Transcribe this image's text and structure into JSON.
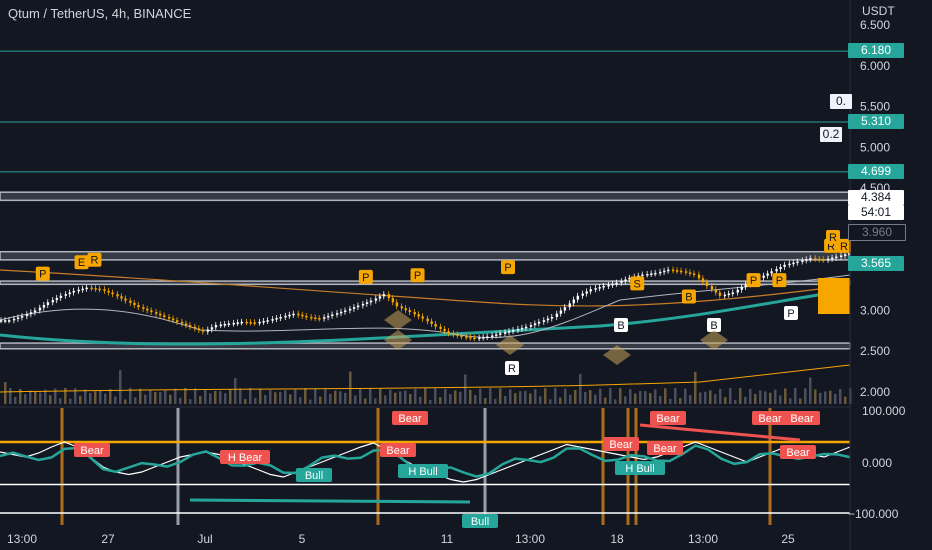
{
  "header": {
    "title": "Qtum / TetherUS, 4h, BINANCE",
    "currency": "USDT"
  },
  "chart_data": [
    {
      "type": "line",
      "title": "Qtum / TetherUS, 4h, BINANCE",
      "x_ticks": [
        "13:00",
        "27",
        "Jul",
        "5",
        "11",
        "13:00",
        "18",
        "13:00",
        "25"
      ],
      "y_ticks": [
        "6.500",
        "6.000",
        "5.500",
        "5.000",
        "4.500",
        "3.000",
        "2.500",
        "2.000"
      ],
      "ylim": [
        1.85,
        6.6
      ],
      "price_labels": [
        {
          "label": "6.180",
          "value": 6.18,
          "color": "#26a69a"
        },
        {
          "label": "5.310",
          "value": 5.31,
          "color": "#26a69a"
        },
        {
          "label": "4.699",
          "value": 4.699,
          "color": "#26a69a"
        },
        {
          "label": "4.384",
          "value": 4.384,
          "color": "#ffffff"
        },
        {
          "label": "54:01",
          "value": 4.28,
          "color": "#ffffff"
        },
        {
          "label": "3.960",
          "value": 3.96,
          "color": "#131722"
        },
        {
          "label": "3.565",
          "value": 3.565,
          "color": "#26a69a"
        }
      ],
      "fib_labels": [
        {
          "label": "0.",
          "value": 5.55
        },
        {
          "label": "0.2",
          "value": 5.15
        }
      ],
      "horizontal_lines": [
        6.18,
        5.31,
        4.699
      ],
      "zones": [
        [
          4.35,
          4.45
        ],
        [
          3.62,
          3.72
        ],
        [
          3.32,
          3.36
        ],
        [
          2.53,
          2.6
        ]
      ],
      "close": [
        2.88,
        2.93,
        3.0,
        3.1,
        3.18,
        3.24,
        3.28,
        3.26,
        3.2,
        3.12,
        3.04,
        2.98,
        2.92,
        2.86,
        2.8,
        2.74,
        2.82,
        2.84,
        2.86,
        2.85,
        2.88,
        2.92,
        2.96,
        2.92,
        2.9,
        2.95,
        3.0,
        3.06,
        3.12,
        3.2,
        3.05,
        2.98,
        2.9,
        2.8,
        2.72,
        2.68,
        2.66,
        2.68,
        2.72,
        2.76,
        2.8,
        2.86,
        2.92,
        3.04,
        3.18,
        3.26,
        3.3,
        3.34,
        3.4,
        3.44,
        3.46,
        3.5,
        3.48,
        3.44,
        3.3,
        3.18,
        3.22,
        3.32,
        3.4,
        3.48,
        3.56,
        3.6,
        3.64,
        3.62,
        3.66,
        3.7
      ],
      "series_markers": {
        "signals": [
          {
            "label": "P",
            "i": 3,
            "v": 3.28
          },
          {
            "label": "E",
            "i": 6,
            "v": 3.42
          },
          {
            "label": "R",
            "i": 7,
            "v": 3.45
          },
          {
            "label": "P",
            "i": 28,
            "v": 3.24
          },
          {
            "label": "P",
            "i": 32,
            "v": 3.26
          },
          {
            "label": "P",
            "i": 39,
            "v": 3.36
          },
          {
            "label": "S",
            "i": 49,
            "v": 3.16
          },
          {
            "label": "B",
            "i": 53,
            "v": 3.0
          },
          {
            "label": "P",
            "i": 58,
            "v": 3.2
          },
          {
            "label": "P",
            "i": 60,
            "v": 3.2
          },
          {
            "label": "R",
            "i": 64,
            "v": 3.62
          },
          {
            "label": "R",
            "i": 65,
            "v": 3.62
          }
        ]
      },
      "white_tags": [
        "R",
        "B",
        "B",
        "P",
        "R"
      ],
      "volume_range": [
        1.85,
        2.35
      ]
    },
    {
      "type": "line",
      "ylim": [
        -110,
        110
      ],
      "y_ticks": [
        "100.000",
        "0.000",
        "−100.000"
      ],
      "levels": [
        40,
        -45,
        -105
      ],
      "labels": [
        "Bear",
        "Bear",
        "H Bear",
        "Bull",
        "Bear",
        "H Bull",
        "Bear",
        "H Bull",
        "Bear",
        "Bear",
        "Bear",
        "Bear",
        "Bear",
        "Bull"
      ],
      "oscillator": [
        20,
        15,
        10,
        18,
        30,
        40,
        30,
        10,
        -10,
        -20,
        -25,
        -20,
        -10,
        0,
        10,
        15,
        20,
        15,
        5,
        -5,
        -15,
        -25,
        -30,
        -20,
        -10,
        0,
        10,
        20,
        30,
        38,
        25,
        10,
        -5,
        -15,
        -25,
        -35,
        -40,
        -35,
        -25,
        -15,
        -5,
        5,
        15,
        25,
        35,
        30,
        25,
        20,
        15,
        10,
        5,
        10,
        20,
        30,
        40,
        30,
        20,
        10,
        0,
        10,
        20,
        30,
        25,
        15,
        10,
        20,
        30
      ]
    }
  ]
}
